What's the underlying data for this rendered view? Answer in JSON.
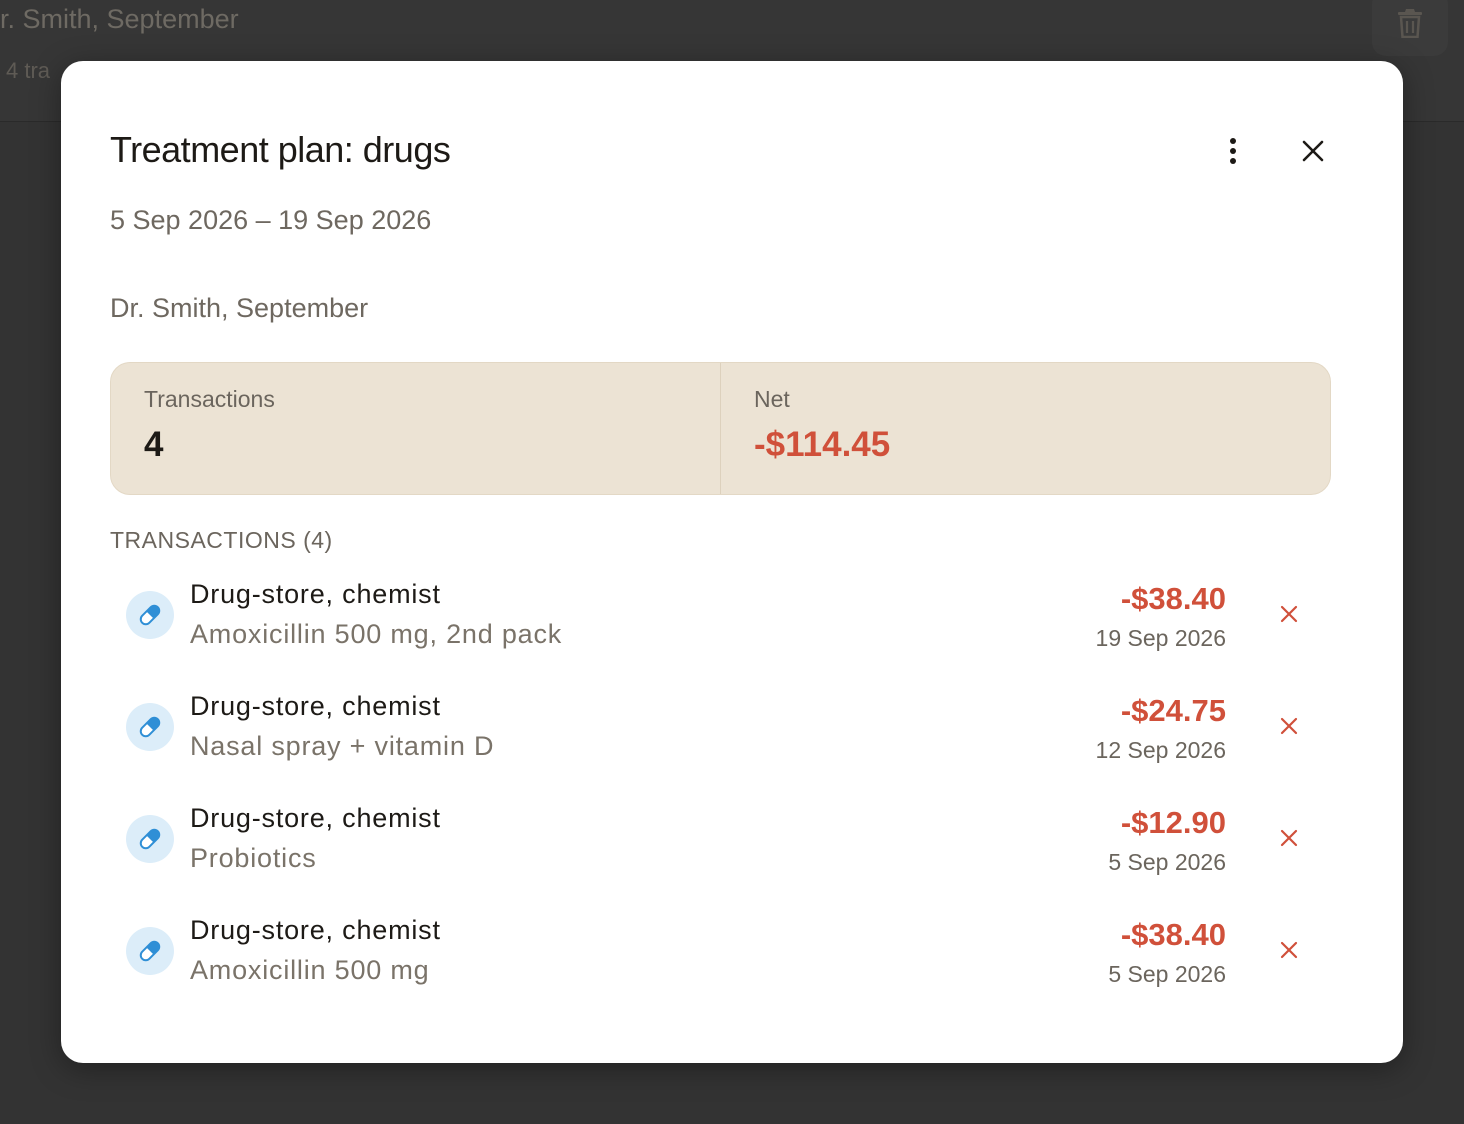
{
  "background": {
    "title": "r. Smith, September",
    "subtitle": "4 tra",
    "trash_icon": "trash-icon"
  },
  "modal": {
    "title": "Treatment plan: drugs",
    "date_range": "5 Sep 2026 – 19 Sep 2026",
    "note": "Dr. Smith, September",
    "more_icon": "more-vertical-icon",
    "close_icon": "close-icon"
  },
  "summary": {
    "transactions_label": "Transactions",
    "transactions_value": "4",
    "net_label": "Net",
    "net_value": "-$114.45"
  },
  "transactions_section": {
    "title": "TRANSACTIONS (4)",
    "items": [
      {
        "merchant": "Drug-store, chemist",
        "description": "Amoxicillin 500 mg, 2nd pack",
        "amount": "-$38.40",
        "date": "19 Sep 2026",
        "icon": "pill-icon"
      },
      {
        "merchant": "Drug-store, chemist",
        "description": "Nasal spray + vitamin D",
        "amount": "-$24.75",
        "date": "12 Sep 2026",
        "icon": "pill-icon"
      },
      {
        "merchant": "Drug-store, chemist",
        "description": "Probiotics",
        "amount": "-$12.90",
        "date": "5 Sep 2026",
        "icon": "pill-icon"
      },
      {
        "merchant": "Drug-store, chemist",
        "description": "Amoxicillin 500 mg",
        "amount": "-$38.40",
        "date": "5 Sep 2026",
        "icon": "pill-icon"
      }
    ]
  },
  "colors": {
    "negative": "#d0503a",
    "summary_bg": "#ece3d4",
    "icon_bg": "#dcedf9",
    "icon_fg": "#2f8fd6"
  }
}
